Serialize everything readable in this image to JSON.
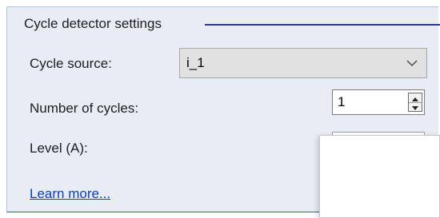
{
  "group": {
    "title": "Cycle detector settings"
  },
  "fields": {
    "cycle_source_label": "Cycle source:",
    "cycle_source_value": "i_1",
    "number_of_cycles_label": "Number of cycles:",
    "number_of_cycles_value": "1",
    "level_label": "Level (A):",
    "level_value": ""
  },
  "links": {
    "learn_more": "Learn more..."
  },
  "icons": {
    "dropdown": "chevron-down-icon",
    "spin_up": "triangle-up-icon",
    "spin_down": "triangle-down-icon"
  },
  "colors": {
    "panel_bg": "#e8ecf5",
    "group_line": "#1f3f8a",
    "link": "#0a3fc4"
  }
}
